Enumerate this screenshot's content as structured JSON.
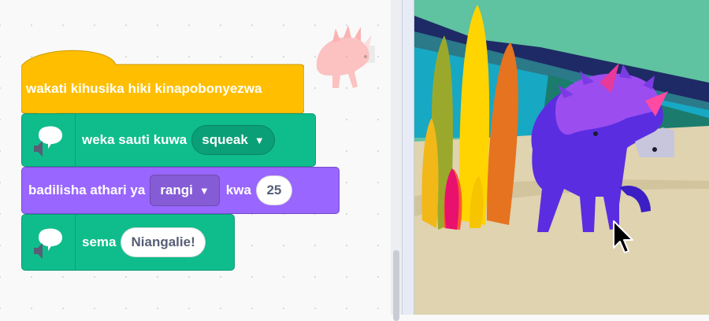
{
  "code_area": {
    "blocks": {
      "hat": {
        "label": "wakati kihusika hiki kinapobonyezwa"
      },
      "sound": {
        "label": "weka sauti kuwa",
        "dropdown_value": "squeak"
      },
      "looks": {
        "label_prefix": "badilisha athari ya",
        "dropdown_value": "rangi",
        "label_middle": "kwa",
        "value": "25"
      },
      "say": {
        "label": "sema",
        "value": "Niangalie!"
      }
    },
    "icons": {
      "speaker": "speaker-icon",
      "speech_bubble": "speech-bubble-icon",
      "caret": "caret-down-icon"
    },
    "colors": {
      "events": "#ffbf00",
      "extension_green": "#0fbd8c",
      "looks_purple": "#9966ff"
    }
  },
  "stage": {
    "sprite": "triceratops",
    "backdrop": "desert"
  }
}
